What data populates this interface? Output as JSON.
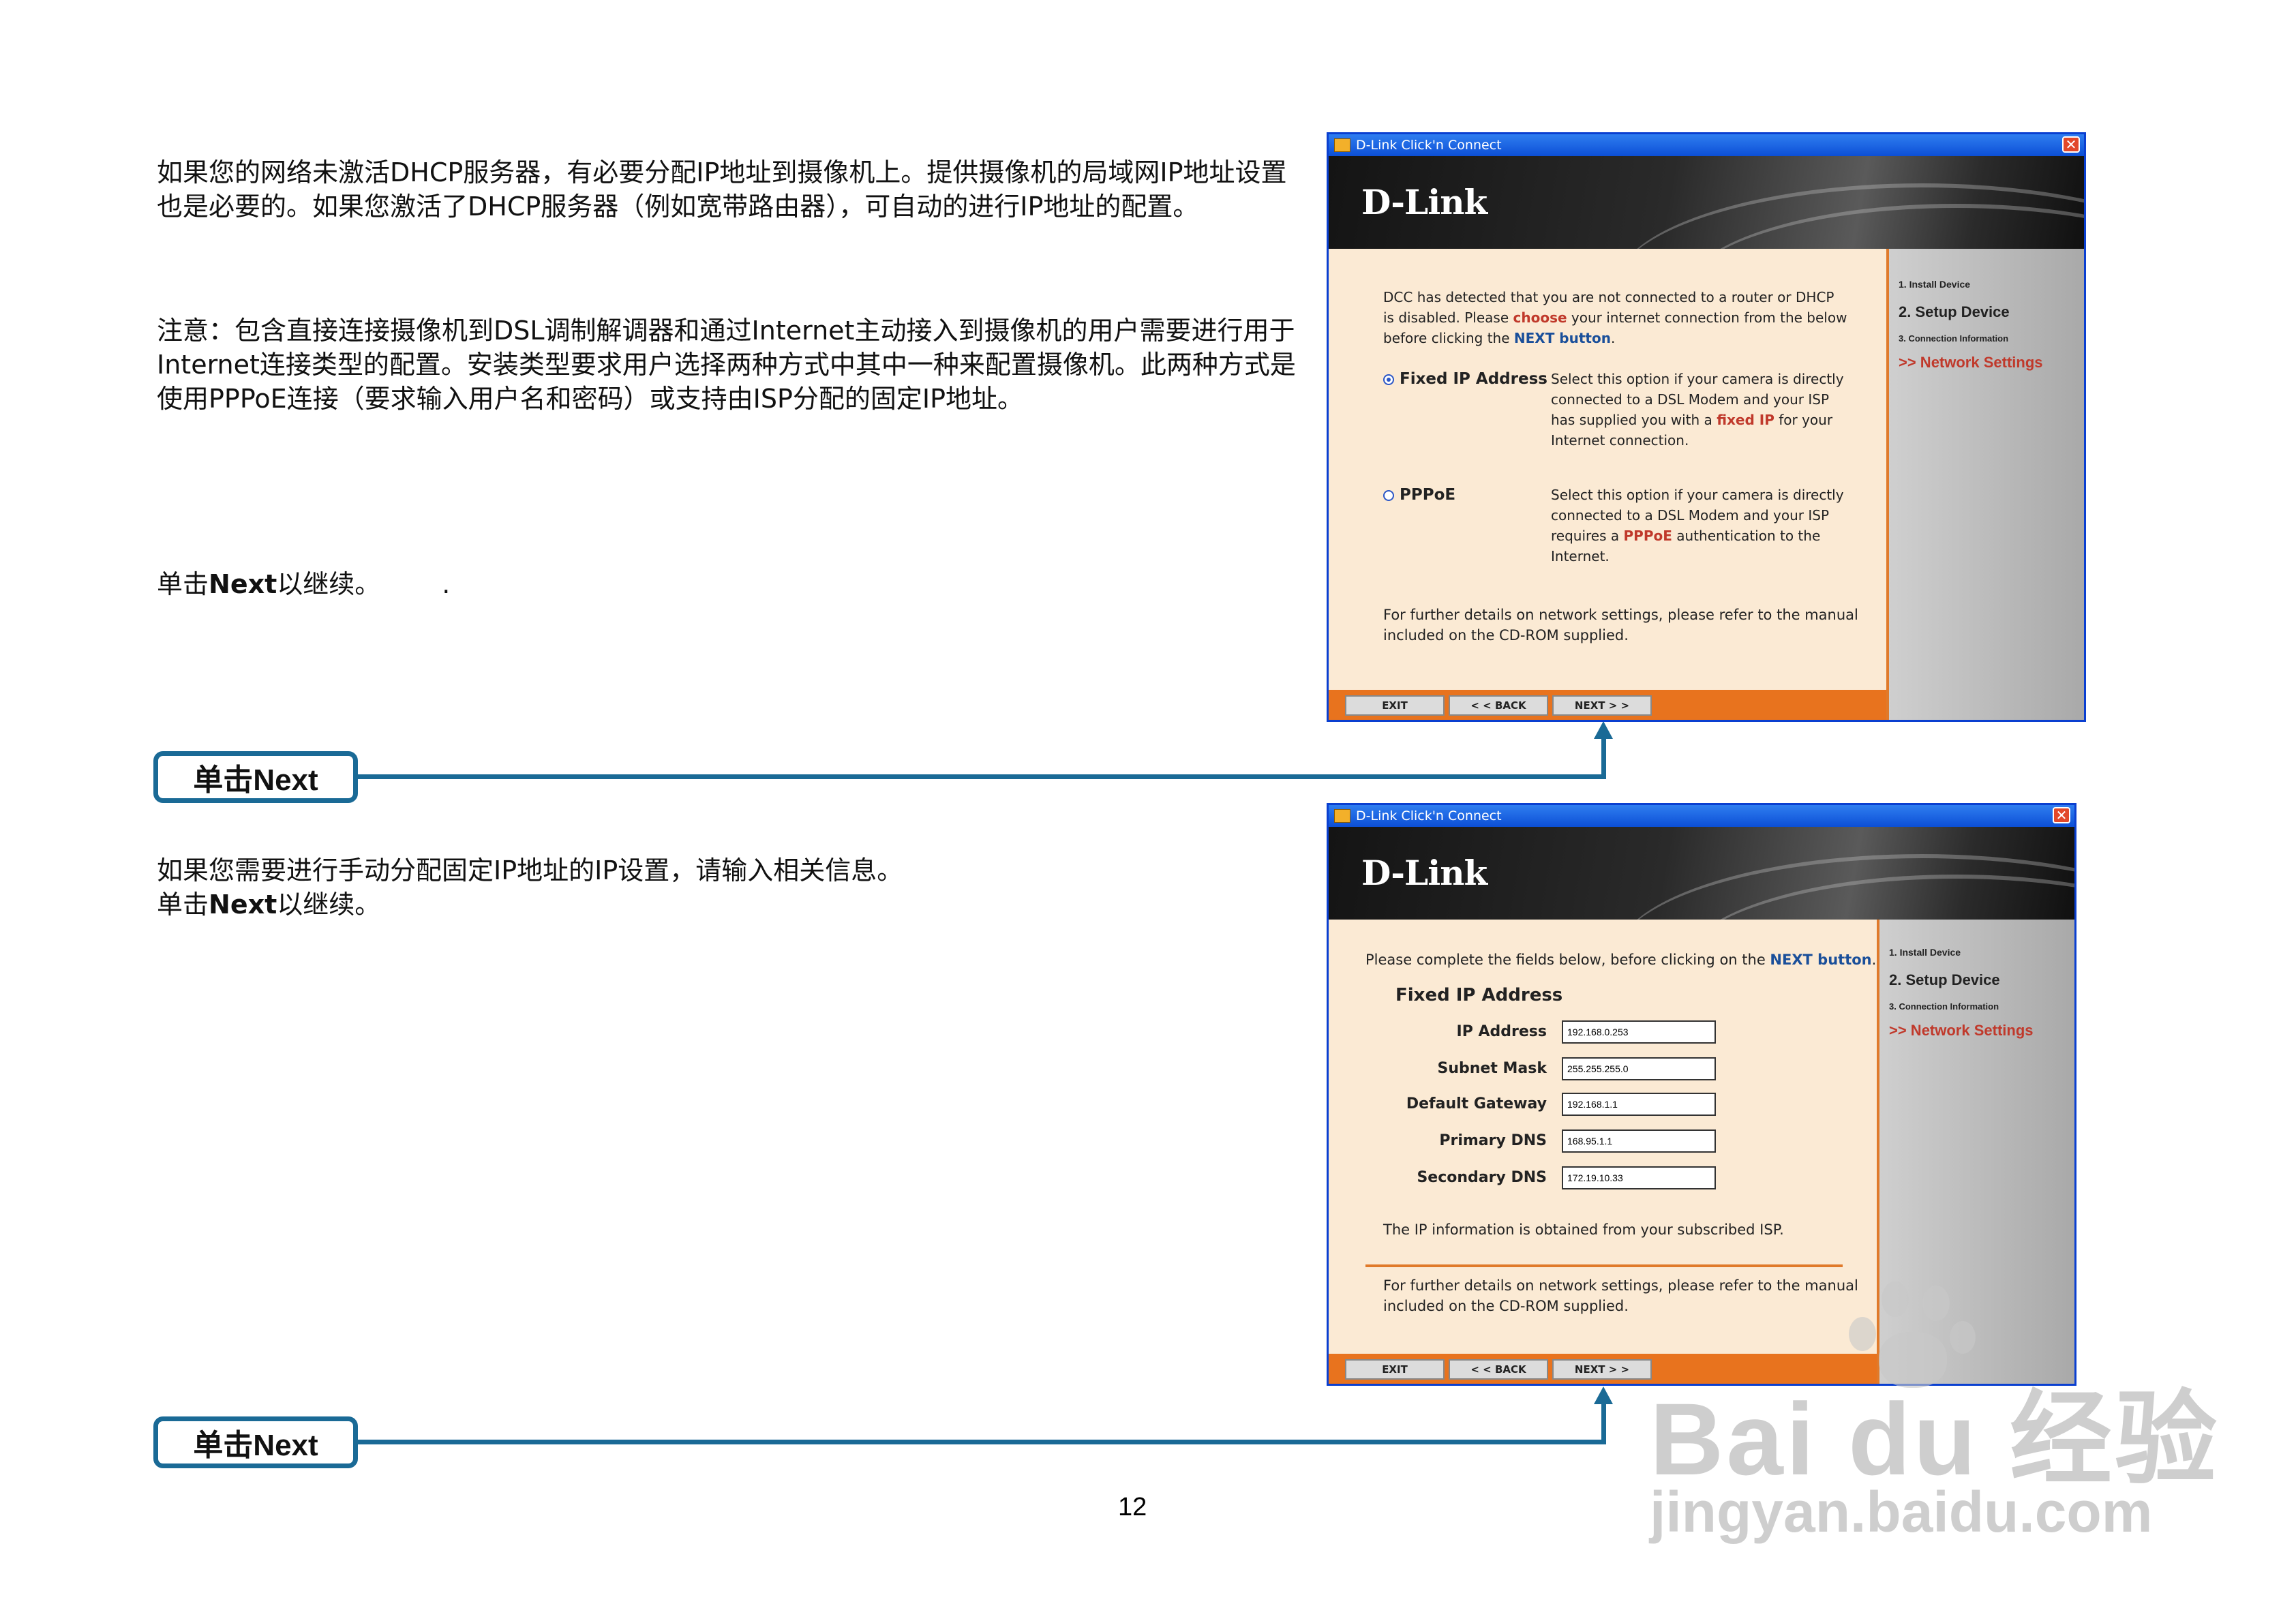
{
  "instructions": {
    "para1": "如果您的网络未激活DHCP服务器，有必要分配IP地址到摄像机上。提供摄像机的局域网IP地址设置也是必要的。如果您激活了DHCP服务器（例如宽带路由器），可自动的进行IP地址的配置。",
    "para2": "注意：包含直接连接摄像机到DSL调制解调器和通过Internet主动接入到摄像机的用户需要进行用于Internet连接类型的配置。安装类型要求用户选择两种方式中其中一种来配置摄像机。此两种方式是使用PPPoE连接（要求输入用户名和密码）或支持由ISP分配的固定IP地址。",
    "para3_prefix": "单击",
    "para3_bold": "Next",
    "para3_suffix": "以继续。",
    "para3_dot": ".",
    "para4": "如果您需要进行手动分配固定IP地址的IP设置，请输入相关信息。",
    "para5_prefix": "单击",
    "para5_bold": "Next",
    "para5_suffix": "以继续。"
  },
  "callouts": [
    "单击Next",
    "单击Next"
  ],
  "page_number": "12",
  "dialog1": {
    "title": "D-Link Click'n Connect",
    "logo": "D-Link",
    "intro_a": "DCC has detected that you are not connected to a router or DHCP",
    "intro_b1": "is disabled. Please ",
    "intro_b_hl": "choose",
    "intro_b2": " your internet connection from the below",
    "intro_c1": "before clicking the ",
    "intro_c_hl": "NEXT button",
    "intro_c2": ".",
    "opt1_label": "Fixed IP Address",
    "opt1_l1": "Select this option if your camera is directly",
    "opt1_l2": "connected to a DSL Modem and your ISP",
    "opt1_l3a": "has supplied you with a ",
    "opt1_l3_hl": "fixed IP",
    "opt1_l3b": " for your",
    "opt1_l4": "Internet connection.",
    "opt2_label": "PPPoE",
    "opt2_l1": "Select this option if your camera is directly",
    "opt2_l2": "connected to a DSL Modem and your ISP",
    "opt2_l3a": "requires a ",
    "opt2_l3_hl": "PPPoE",
    "opt2_l3b": " authentication to the",
    "opt2_l4": "Internet.",
    "footer_l1": "For further details on network settings, please refer to the manual",
    "footer_l2": "included on the CD-ROM supplied.",
    "buttons": [
      "EXIT",
      "< < BACK",
      "NEXT > >"
    ],
    "sidebar": [
      "1. Install Device",
      "2. Setup Device",
      "3. Connection Information",
      ">> Network Settings"
    ]
  },
  "dialog2": {
    "title": "D-Link Click'n Connect",
    "logo": "D-Link",
    "intro1": "Please complete the fields below, before clicking on the ",
    "intro_hl": "NEXT button",
    "intro2": ".",
    "section": "Fixed IP Address",
    "fields": [
      {
        "label": "IP Address",
        "value": "192.168.0.253"
      },
      {
        "label": "Subnet Mask",
        "value": "255.255.255.0"
      },
      {
        "label": "Default Gateway",
        "value": "192.168.1.1"
      },
      {
        "label": "Primary DNS",
        "value": "168.95.1.1"
      },
      {
        "label": "Secondary DNS",
        "value": "172.19.10.33"
      }
    ],
    "isp_note": "The IP information is obtained from your subscribed ISP.",
    "footer_l1": "For further details on network settings, please refer to the manual",
    "footer_l2": "included on the CD-ROM supplied.",
    "buttons": [
      "EXIT",
      "< < BACK",
      "NEXT > >"
    ],
    "sidebar": [
      "1. Install Device",
      "2. Setup Device",
      "3. Connection Information",
      ">> Network Settings"
    ]
  },
  "watermark": {
    "brand": "Bai du 经验",
    "url": "jingyan.baidu.com"
  }
}
